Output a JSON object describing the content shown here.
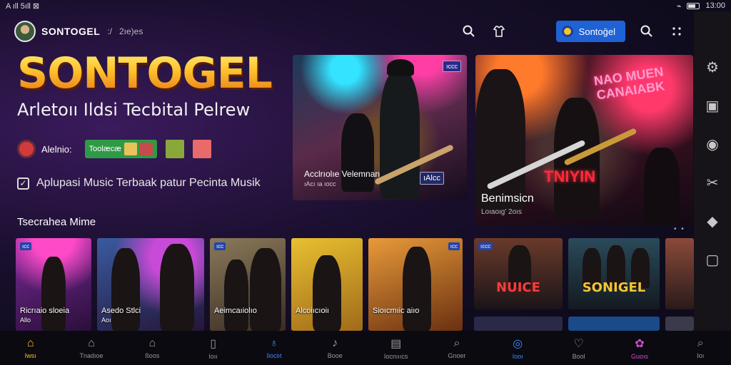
{
  "statusbar": {
    "left": "A ıll 5ıll ⊠",
    "right_time": "13:00"
  },
  "header": {
    "brand": "SONTOGEL",
    "separator": ":/",
    "subtitle": "2ıe)es",
    "cta_label": "Sontoḡel"
  },
  "hero": {
    "title": "SONTOGEL",
    "tagline": "Arletoıı Ildsi Tecbital Pelrew",
    "row_label": "Alelnio:",
    "chip_label": "Toolæcæ",
    "check_text": "Aplupasi Music Terbaak patur Pecinta Musik"
  },
  "featured": [
    {
      "caption": "Acclrıolıe Velemnan",
      "badge": "ıAlcc",
      "subcaption": "ıAcı ıa ıocc",
      "top_badge": "ıccc"
    },
    {
      "title": "Benimsicn",
      "subtitle": "Loıaoıg' 2oıs",
      "sign": "NAO MUEN\nCANAIABK",
      "logo": "TNIYIN"
    }
  ],
  "section": {
    "title": "Tsecrahea Mime",
    "cards": [
      {
        "caption": "Ricrıaio sloeia",
        "subcaption": "Allo",
        "badge": "ıcc",
        "tag": ""
      },
      {
        "caption": "Asedo Stlci",
        "subcaption": "Aoı",
        "badge": "",
        "tag": ""
      },
      {
        "caption": "Aeimcaıiolıo",
        "subcaption": "",
        "badge": "ıcc",
        "tag": ""
      },
      {
        "caption": "Alcoiıcıoiı",
        "subcaption": "",
        "badge": "",
        "tag": ""
      },
      {
        "caption": "Sioıcmıic aiıo",
        "subcaption": "",
        "badge": "ıcc",
        "tag": ""
      },
      {
        "caption": "",
        "subcaption": "",
        "badge": "ıccc",
        "tag": "NUICE"
      },
      {
        "caption": "",
        "subcaption": "",
        "badge": "",
        "tag": "SONIGEL"
      },
      {
        "caption": "",
        "subcaption": "",
        "badge": "",
        "tag": ""
      }
    ]
  },
  "bottom_nav": [
    {
      "label": "Iwsı",
      "icon": "home-icon",
      "active": true
    },
    {
      "label": "Tnadıoe",
      "icon": "house-icon"
    },
    {
      "label": "ßoos",
      "icon": "library-icon"
    },
    {
      "label": "Ioıı",
      "icon": "card-icon"
    },
    {
      "label": "Iiociıt",
      "icon": "mic-icon",
      "active_blue": true
    },
    {
      "label": "Booe",
      "icon": "note-icon"
    },
    {
      "label": "Iocnıııcs",
      "icon": "album-icon"
    },
    {
      "label": "Gnoer",
      "icon": "search-icon"
    },
    {
      "label": "Iooı",
      "icon": "disc-icon"
    },
    {
      "label": "Bool",
      "icon": "heart-icon"
    },
    {
      "label": "Guoıs",
      "icon": "podcast-icon",
      "active_pink": true
    },
    {
      "label": "Ioı",
      "icon": "search-small-icon"
    }
  ],
  "colors": {
    "accent_blue": "#1e62d6",
    "gold": "#ffb21e",
    "nav_active": "#f4c531",
    "pink": "#d94ad0"
  }
}
